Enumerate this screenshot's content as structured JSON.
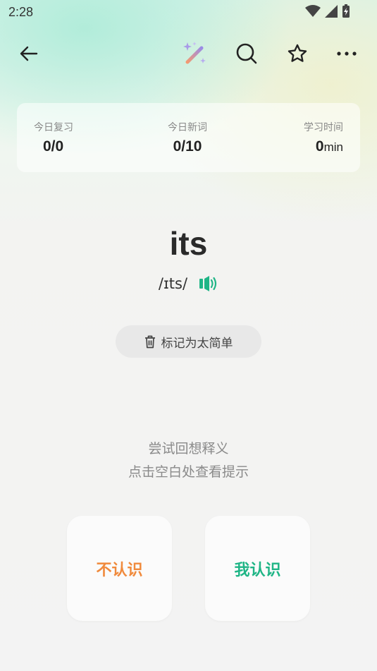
{
  "status_bar": {
    "time": "2:28"
  },
  "toolbar": {
    "back_icon": "arrow-left-icon",
    "magic_icon": "magic-wand-icon",
    "search_icon": "search-icon",
    "star_icon": "star-icon",
    "more_icon": "more-horizontal-icon"
  },
  "stats": {
    "review": {
      "label": "今日复习",
      "value": "0/0"
    },
    "new_words": {
      "label": "今日新词",
      "value": "0/10"
    },
    "study_time": {
      "label": "学习时间",
      "value": "0",
      "unit": "min"
    }
  },
  "card": {
    "word": "its",
    "phonetic": "/ɪts/",
    "speaker_icon": "speaker-icon",
    "speaker_color": "#1fb586",
    "mark_easy_label": "标记为太简单",
    "trash_icon": "trash-icon"
  },
  "hint": {
    "line1": "尝试回想释义",
    "line2": "点击空白处查看提示"
  },
  "choices": {
    "unknown_label": "不认识",
    "unknown_color": "#f08a3c",
    "known_label": "我认识",
    "known_color": "#1fb586"
  }
}
